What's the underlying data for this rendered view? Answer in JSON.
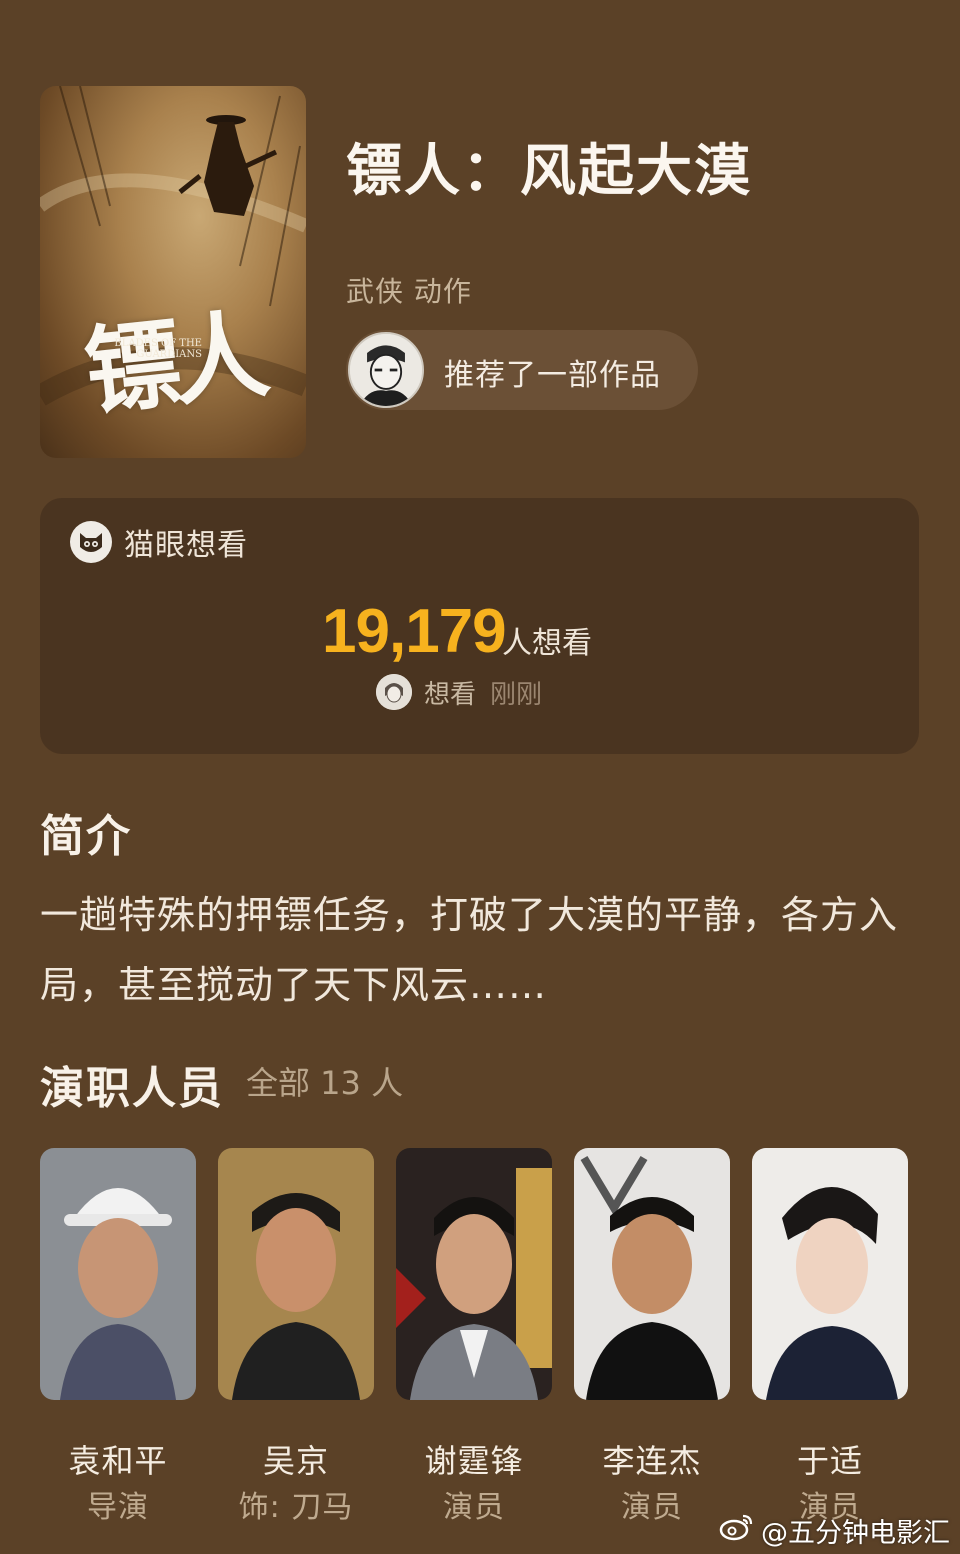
{
  "movie": {
    "poster_title": "镖人",
    "poster_subtitle": "BLADES OF THE GUARDIANS",
    "title": "镖人：风起大漠",
    "genres": "武侠 动作",
    "recommend_text": "推荐了一部作品"
  },
  "want_card": {
    "source_label": "猫眼想看",
    "count": "19,179",
    "count_unit": "人想看",
    "recent_action": "想看",
    "recent_time": "刚刚",
    "count_color": "#f7b21e"
  },
  "synopsis": {
    "heading": "简介",
    "text": "一趟特殊的押镖任务，打破了大漠的平静，各方入局，甚至搅动了天下风云……"
  },
  "cast": {
    "heading": "演职人员",
    "total": "全部 13 人",
    "members": [
      {
        "name": "袁和平",
        "role": "导演"
      },
      {
        "name": "吴京",
        "role": "饰: 刀马"
      },
      {
        "name": "谢霆锋",
        "role": "演员"
      },
      {
        "name": "李连杰",
        "role": "演员"
      },
      {
        "name": "于适",
        "role": "演员"
      }
    ]
  },
  "watermark": "@五分钟电影汇",
  "icons": {
    "maoyan": "maoyan-cat-icon",
    "weibo": "weibo-icon"
  }
}
